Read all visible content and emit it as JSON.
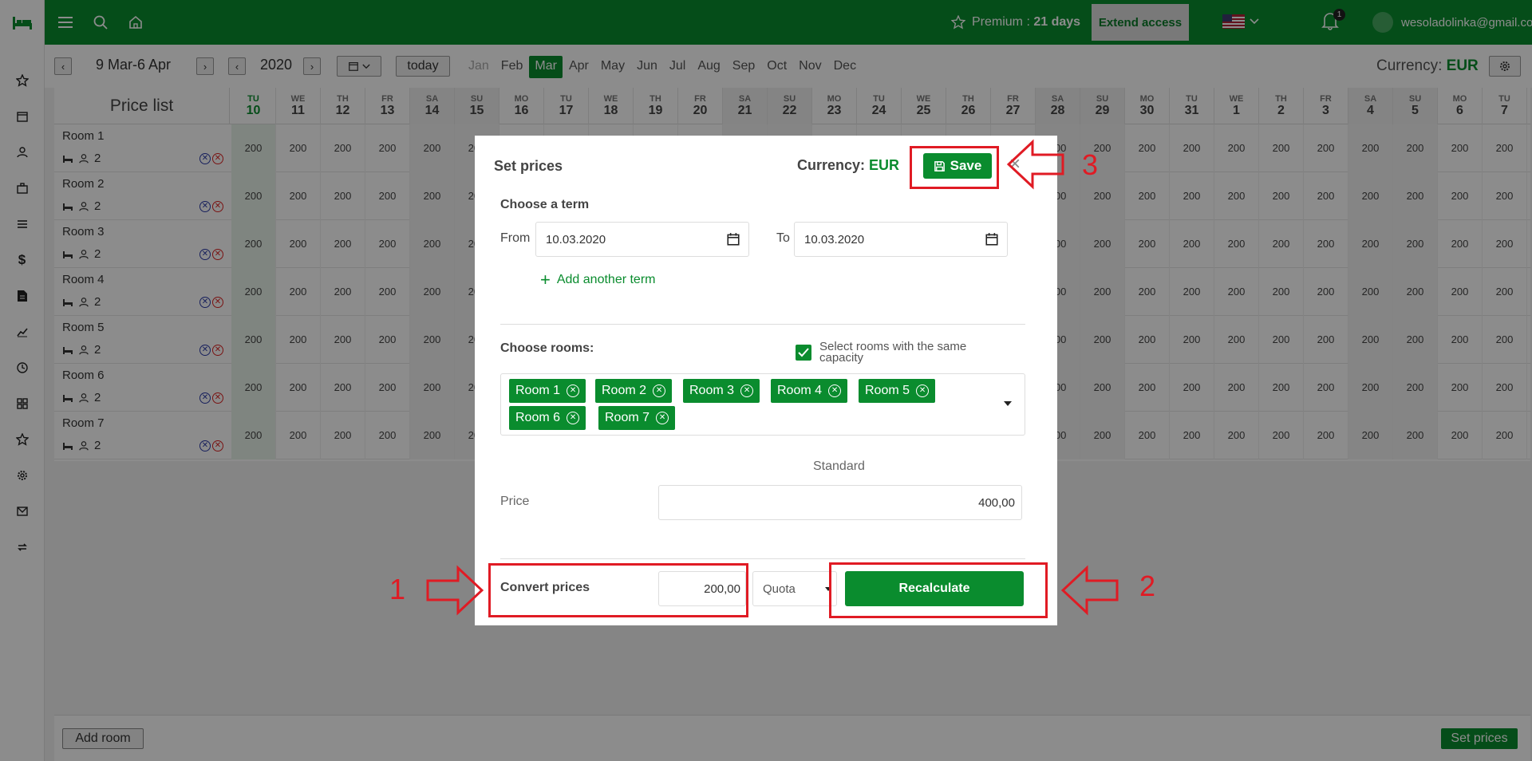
{
  "topbar": {
    "premium_label": "Premium : ",
    "premium_days": "21 days",
    "extend_label": "Extend access",
    "notif_count": "1",
    "user_email": "wesoladolinka@gmail.com"
  },
  "toolbar": {
    "date_range": "9 Mar-6 Apr",
    "year": "2020",
    "today_label": "today",
    "months": [
      "Jan",
      "Feb",
      "Mar",
      "Apr",
      "May",
      "Jun",
      "Jul",
      "Aug",
      "Sep",
      "Oct",
      "Nov",
      "Dec"
    ],
    "active_month": "Mar",
    "currency_label": "Currency: ",
    "currency_value": "EUR"
  },
  "grid": {
    "title": "Price list",
    "days": [
      {
        "dn": "TU",
        "dd": "10"
      },
      {
        "dn": "WE",
        "dd": "11"
      },
      {
        "dn": "TH",
        "dd": "12"
      },
      {
        "dn": "FR",
        "dd": "13"
      },
      {
        "dn": "SA",
        "dd": "14"
      },
      {
        "dn": "SU",
        "dd": "15"
      },
      {
        "dn": "MO",
        "dd": "16"
      },
      {
        "dn": "TU",
        "dd": "17"
      },
      {
        "dn": "WE",
        "dd": "18"
      },
      {
        "dn": "TH",
        "dd": "19"
      },
      {
        "dn": "FR",
        "dd": "20"
      },
      {
        "dn": "SA",
        "dd": "21"
      },
      {
        "dn": "SU",
        "dd": "22"
      },
      {
        "dn": "MO",
        "dd": "23"
      },
      {
        "dn": "TU",
        "dd": "24"
      },
      {
        "dn": "WE",
        "dd": "25"
      },
      {
        "dn": "TH",
        "dd": "26"
      },
      {
        "dn": "FR",
        "dd": "27"
      },
      {
        "dn": "SA",
        "dd": "28"
      },
      {
        "dn": "SU",
        "dd": "29"
      },
      {
        "dn": "MO",
        "dd": "30"
      },
      {
        "dn": "TU",
        "dd": "31"
      },
      {
        "dn": "WE",
        "dd": "1"
      },
      {
        "dn": "TH",
        "dd": "2"
      },
      {
        "dn": "FR",
        "dd": "3"
      },
      {
        "dn": "SA",
        "dd": "4"
      },
      {
        "dn": "SU",
        "dd": "5"
      },
      {
        "dn": "MO",
        "dd": "6"
      },
      {
        "dn": "TU",
        "dd": "7"
      }
    ],
    "rooms": [
      {
        "name": "Room 1",
        "capacity": "2"
      },
      {
        "name": "Room 2",
        "capacity": "2"
      },
      {
        "name": "Room 3",
        "capacity": "2"
      },
      {
        "name": "Room 4",
        "capacity": "2"
      },
      {
        "name": "Room 5",
        "capacity": "2"
      },
      {
        "name": "Room 6",
        "capacity": "2"
      },
      {
        "name": "Room 7",
        "capacity": "2"
      }
    ],
    "cell_value": "200"
  },
  "bottom": {
    "add_room": "Add room",
    "set_prices": "Set prices"
  },
  "modal": {
    "title": "Set prices",
    "currency_label": "Currency: ",
    "currency_value": "EUR",
    "save_label": "Save",
    "term_label": "Choose a term",
    "from_label": "From",
    "from_value": "10.03.2020",
    "to_label": "To",
    "to_value": "10.03.2020",
    "add_term": "Add another term",
    "rooms_label": "Choose rooms:",
    "same_capacity_label": "Select rooms with the same capacity",
    "chips": [
      "Room 1",
      "Room 2",
      "Room 3",
      "Room 4",
      "Room 5",
      "Room 6",
      "Room 7"
    ],
    "price_col": "Standard",
    "price_label": "Price",
    "price_value": "400,00",
    "convert_label": "Convert prices",
    "convert_value": "200,00",
    "quota_value": "Quota",
    "recalc_label": "Recalculate"
  },
  "annotations": {
    "n1": "1",
    "n2": "2",
    "n3": "3"
  }
}
